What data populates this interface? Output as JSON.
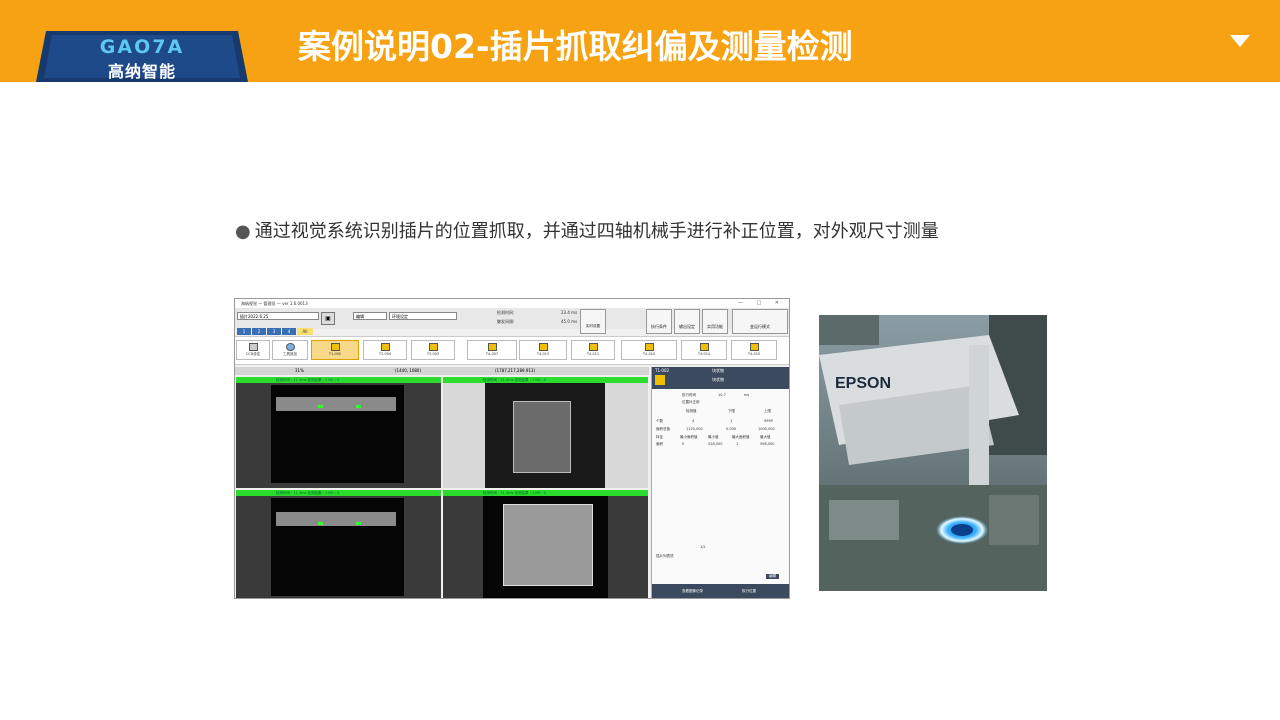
{
  "header": {
    "logo_en": "GAO7A",
    "logo_cn": "高纳智能",
    "title": "案例说明02-插片抓取纠偏及测量检测"
  },
  "bullet": {
    "text": "通过视觉系统识别插片的位置抓取，并通过四轴机械手进行补正位置，对外观尺寸测量"
  },
  "software": {
    "window_title": "海纳视觉 — 管理员 — ver 1.6.0013",
    "window_controls": "— □ ✕",
    "project_select": "插片2022.6.25",
    "edit_menu": "编辑",
    "env_menu": "环境设定",
    "stat1_label": "检测时间:",
    "stat1_value": "23.4 ms",
    "stat2_label": "触发间隔:",
    "stat2_value": "45.0 ms",
    "realtime_btn": "实时设置",
    "big_buttons": [
      "执行条件",
      "输出设定",
      "实用功能",
      "变运行模式"
    ],
    "cam_tabs": [
      "1",
      "2",
      "3",
      "4",
      "All"
    ],
    "ribbon_left": [
      "CCD设定",
      "工具追加"
    ],
    "tools": [
      {
        "id": "T1-002",
        "name": "块状物"
      },
      {
        "id": "T2-004",
        "name": "块状物"
      },
      {
        "id": "T3-003",
        "name": "块状物"
      },
      {
        "id": "T4-007",
        "name": "形状检出"
      },
      {
        "id": "T4-013",
        "name": "位置"
      },
      {
        "id": "T4-011",
        "name": "线"
      },
      {
        "id": "T4-010",
        "name": "边缘宽幅检出"
      },
      {
        "id": "T4-014",
        "name": "计量模块"
      },
      {
        "id": "T4-015",
        "name": "文本输出"
      }
    ],
    "viewbar": {
      "zoom": "31%",
      "coord1": "(1440, 1080)",
      "coord2": "(1787.217,289.913)"
    },
    "viewport_bar_text": "检测时间 : 11.4ms  检测结果 : 1  NG : 0",
    "side_panel": {
      "tool_id": "T1-002",
      "tool_type": "块状物",
      "tool_name": "块状物",
      "exec_time_label": "执行时间",
      "exec_time_value": "10.7",
      "exec_time_unit": "ms",
      "pos_label": "位置补正用",
      "cols": [
        "检测值",
        "下限",
        "上限"
      ],
      "rows": [
        [
          "个数",
          "4",
          "1",
          "9999"
        ],
        [
          "面积总值",
          "1120,000",
          "0.000",
          "1000,000"
        ]
      ],
      "feature_cols": [
        "特征",
        "最小面积值",
        "最小值",
        "最大面积值",
        "最大值"
      ],
      "feature_row": [
        "面积",
        "0",
        "528,000",
        "1",
        "598,000"
      ],
      "page": "1/2",
      "comment_label": "插片列表项",
      "edit_btn": "编辑",
      "foot_btns": [
        "查看图像记录",
        "执行位置"
      ]
    }
  },
  "photo": {
    "brand_text": "EPSON"
  }
}
